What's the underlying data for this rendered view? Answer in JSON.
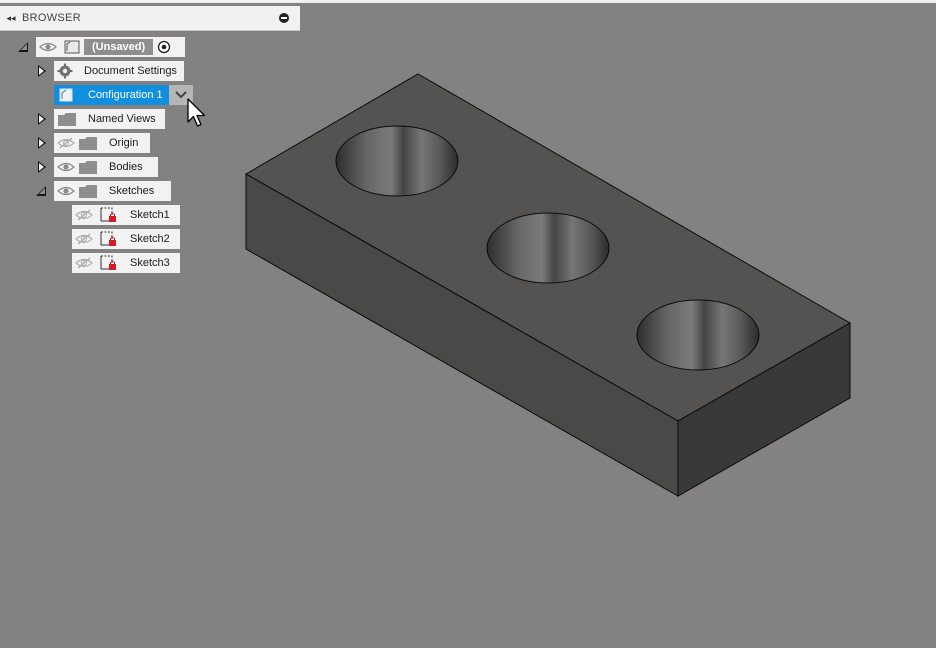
{
  "browser": {
    "title": "BROWSER",
    "collapse_icon": "double-chevron-left-icon",
    "minimize_icon": "minus-circle-icon"
  },
  "tree": {
    "root": {
      "label": "(Unsaved)",
      "expanded": true
    },
    "document_settings": {
      "label": "Document Settings",
      "expanded": false
    },
    "configuration": {
      "label": "Configuration 1",
      "selected": true
    },
    "named_views": {
      "label": "Named Views",
      "expanded": false
    },
    "origin": {
      "label": "Origin",
      "expanded": false,
      "visible": false
    },
    "bodies": {
      "label": "Bodies",
      "expanded": false,
      "visible": true
    },
    "sketches": {
      "label": "Sketches",
      "expanded": true,
      "visible": true,
      "items": [
        {
          "label": "Sketch1",
          "visible": false
        },
        {
          "label": "Sketch2",
          "visible": false
        },
        {
          "label": "Sketch3",
          "visible": false
        }
      ]
    }
  },
  "colors": {
    "background": "#838181",
    "selection": "#0f8fde",
    "body_top": "#555352",
    "body_front": "#4a4948",
    "body_side": "#3a393a",
    "sketch_badge": "#d21a28"
  },
  "model": {
    "type": "rectangular block",
    "hole_count": 3
  }
}
